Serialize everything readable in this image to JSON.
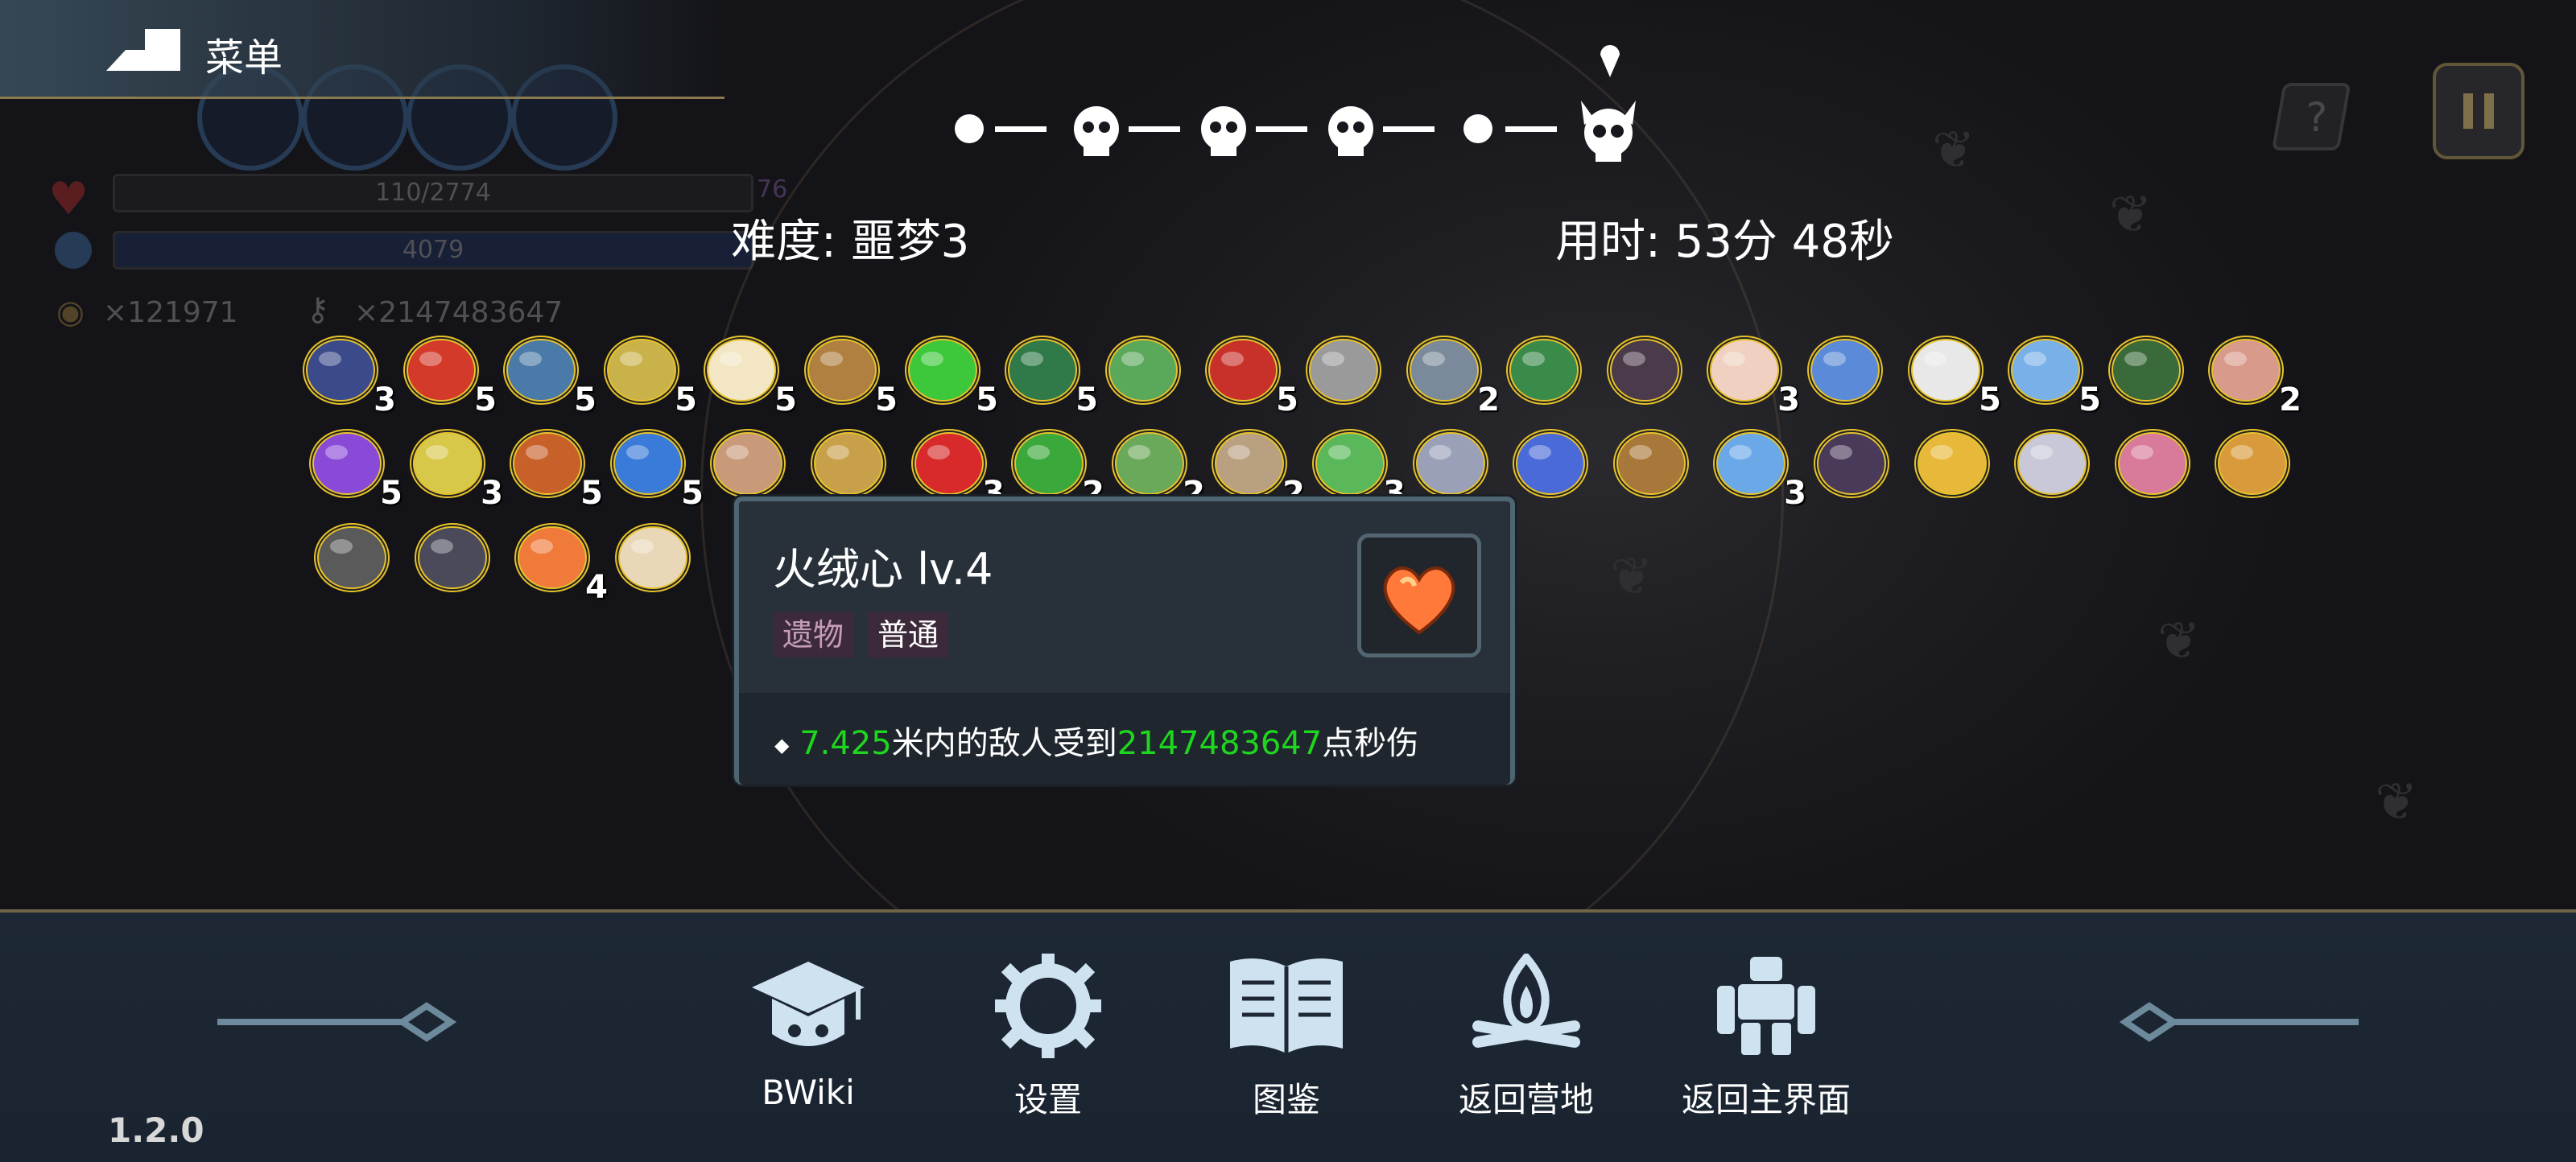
{
  "menu": {
    "label": "菜单"
  },
  "hud": {
    "hp_text": "110/2774",
    "hp_side": "76",
    "mp_text": "4079",
    "coins": "×121971",
    "keys": "×2147483647"
  },
  "stats": {
    "difficulty": "难度: 噩梦3",
    "time": "用时: 53分 48秒"
  },
  "items": [
    {
      "icon": "straw-hat-icon",
      "level": "3",
      "color": "#3b4a8a"
    },
    {
      "icon": "red-eye-icon",
      "level": "5",
      "color": "#d43a2a"
    },
    {
      "icon": "sword-icon",
      "level": "5",
      "color": "#4a7aa8"
    },
    {
      "icon": "cube-icon",
      "level": "5",
      "color": "#c9b24a"
    },
    {
      "icon": "ice-cream-icon",
      "level": "5",
      "color": "#f2e6c4"
    },
    {
      "icon": "pickaxe-icon",
      "level": "5",
      "color": "#b08040"
    },
    {
      "icon": "green-flame-icon",
      "level": "5",
      "color": "#3cc83a"
    },
    {
      "icon": "green-shorts-icon",
      "level": "5",
      "color": "#2f7a48"
    },
    {
      "icon": "leaf-icon",
      "level": "",
      "color": "#5aa85a"
    },
    {
      "icon": "demon-mask-icon",
      "level": "5",
      "color": "#c8302a"
    },
    {
      "icon": "spear-icon",
      "level": "",
      "color": "#9a9a9a"
    },
    {
      "icon": "gauntlet-icon",
      "level": "2",
      "color": "#7a8a9a"
    },
    {
      "icon": "green-helmet-icon",
      "level": "",
      "color": "#3a8a4a"
    },
    {
      "icon": "dark-amulet-icon",
      "level": "",
      "color": "#4a3a4a"
    },
    {
      "icon": "feather-icon",
      "level": "3",
      "color": "#f0d0c0"
    },
    {
      "icon": "crystal-orb-icon",
      "level": "",
      "color": "#5a8ad8"
    },
    {
      "icon": "teeth-icon",
      "level": "5",
      "color": "#e8e8e8"
    },
    {
      "icon": "lotus-icon",
      "level": "5",
      "color": "#7ab0e8"
    },
    {
      "icon": "green-boot-icon",
      "level": "",
      "color": "#3a6a3a"
    },
    {
      "icon": "flesh-arm-icon",
      "level": "2",
      "color": "#d89a8a"
    },
    {
      "icon": "purple-boot-icon",
      "level": "5",
      "color": "#8a4ad8"
    },
    {
      "icon": "antler-icon",
      "level": "3",
      "color": "#d8c84a"
    },
    {
      "icon": "flame-cloak-icon",
      "level": "5",
      "color": "#c8602a"
    },
    {
      "icon": "blue-ring-icon",
      "level": "5",
      "color": "#3a7ad8"
    },
    {
      "icon": "stone-egg-icon",
      "level": "",
      "color": "#c89a7a"
    },
    {
      "icon": "striped-bar-icon",
      "level": "",
      "color": "#c8a04a"
    },
    {
      "icon": "red-orb-icon",
      "level": "3",
      "color": "#d82a2a"
    },
    {
      "icon": "clover-icon",
      "level": "2",
      "color": "#3aa83a"
    },
    {
      "icon": "herb-icon",
      "level": "2",
      "color": "#6aa85a"
    },
    {
      "icon": "bone-club-icon",
      "level": "2",
      "color": "#b8a080"
    },
    {
      "icon": "syringe-icon",
      "level": "3",
      "color": "#5ab85a"
    },
    {
      "icon": "crystal-shard-icon",
      "level": "",
      "color": "#9aa0b8"
    },
    {
      "icon": "potion-bottle-icon",
      "level": "",
      "color": "#4a6ad8"
    },
    {
      "icon": "treasure-chest-icon",
      "level": "",
      "color": "#a8783a"
    },
    {
      "icon": "blue-egg-icon",
      "level": "3",
      "color": "#6aa8e8"
    },
    {
      "icon": "dark-cape-icon",
      "level": "",
      "color": "#4a3a5a"
    },
    {
      "icon": "golden-bell-icon",
      "level": "",
      "color": "#e8b83a"
    },
    {
      "icon": "silver-key-icon",
      "level": "",
      "color": "#c8c8d8"
    },
    {
      "icon": "brain-icon",
      "level": "",
      "color": "#d87a9a"
    },
    {
      "icon": "scroll-icon",
      "level": "",
      "color": "#d89a3a"
    },
    {
      "icon": "skull-mask-icon",
      "level": "",
      "color": "#5a5a5a"
    },
    {
      "icon": "knight-helmet-icon",
      "level": "",
      "color": "#4a4a5a"
    },
    {
      "icon": "fire-heart-icon",
      "level": "4",
      "color": "#f07a3a"
    },
    {
      "icon": "bread-bun-icon",
      "level": "",
      "color": "#e8d8b8"
    }
  ],
  "tooltip": {
    "title": "火绒心 lv.4",
    "tag_type": "遗物",
    "tag_rarity": "普通",
    "desc_value_1": "7.425",
    "desc_text_1": "米内的敌人受到",
    "desc_value_2": "2147483647",
    "desc_text_2": "点秒伤",
    "icon": "fire-heart-icon"
  },
  "bottom_menu": [
    {
      "label": "BWiki",
      "icon": "graduation-cap-icon"
    },
    {
      "label": "设置",
      "icon": "gear-icon"
    },
    {
      "label": "图鉴",
      "icon": "book-icon"
    },
    {
      "label": "返回营地",
      "icon": "campfire-icon"
    },
    {
      "label": "返回主界面",
      "icon": "statue-icon"
    }
  ],
  "version": "1.2.0",
  "colors": {
    "value_green": "#1fd61f",
    "border_gold": "#e6c22a",
    "tooltip_bg": "#28313a"
  }
}
